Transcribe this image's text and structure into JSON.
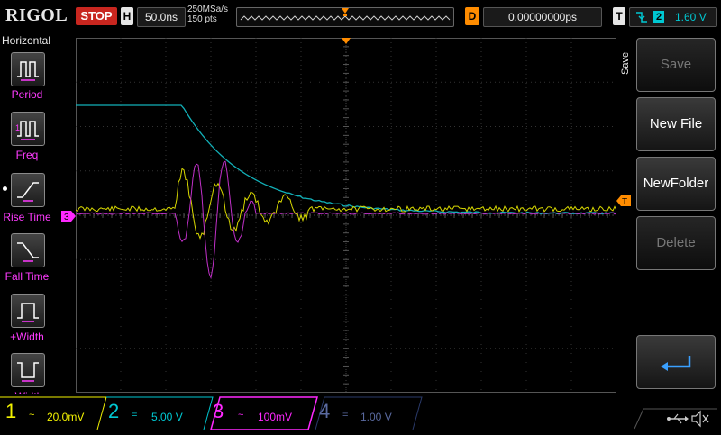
{
  "top": {
    "logo": "RIGOL",
    "run_state": "STOP",
    "h_key": "H",
    "timebase": "50.0ns",
    "sample_rate": "250MSa/s",
    "points": "150 pts",
    "delay_key": "D",
    "delay_value": "0.00000000ps",
    "trigger_key": "T",
    "trigger_source": "2",
    "trigger_level": "1.60 V"
  },
  "left_menu": {
    "title": "Horizontal",
    "items": [
      {
        "label": "Period"
      },
      {
        "label": "Freq"
      },
      {
        "label": "Rise Time"
      },
      {
        "label": "Fall Time"
      },
      {
        "label": "+Width"
      },
      {
        "label": "-Width"
      }
    ]
  },
  "right_menu": {
    "tab": "Save",
    "save": "Save",
    "new_file": "New File",
    "new_folder": "NewFolder",
    "delete": "Delete"
  },
  "markers": {
    "ch3_ref": "3",
    "trig_ref": "T"
  },
  "channels": [
    {
      "num": "1",
      "coupling": "~",
      "scale": "20.0mV",
      "color": "#f2f200"
    },
    {
      "num": "2",
      "coupling": "=",
      "scale": "5.00 V",
      "color": "#00c8d2"
    },
    {
      "num": "3",
      "coupling": "~",
      "scale": "100mV",
      "color": "#ff28ff"
    },
    {
      "num": "4",
      "coupling": "=",
      "scale": "1.00 V",
      "color": "#5a6aa0"
    }
  ],
  "colors": {
    "ch1": "#d8d800",
    "ch2": "#12b0b8",
    "ch3": "#c030c8",
    "trigger": "#ff8c00",
    "stop": "#c8261f"
  }
}
